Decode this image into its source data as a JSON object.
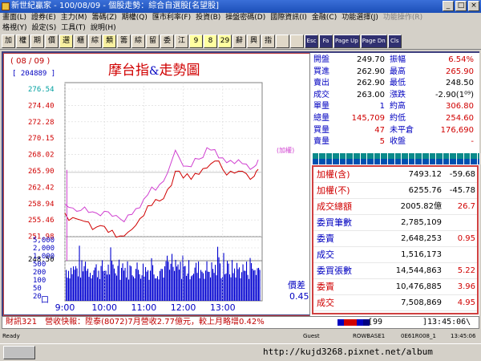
{
  "window": {
    "title": "新世紀贏家 - 100/08/09 - 個股走勢：綜合自選股[名望股]",
    "buttons": [
      "_",
      "□",
      "×"
    ]
  },
  "menu": {
    "row1": [
      "畫面(L)",
      "證券(E)",
      "主力(M)",
      "籌碼(Z)",
      "期權(Q)",
      "匯市利率(F)",
      "投資(B)",
      "操盤密碼(D)",
      "國際資訊(I)",
      "金融(C)",
      "功能選擇(J)",
      "功能操作(R)"
    ],
    "row1_dim": [
      false,
      false,
      false,
      false,
      false,
      false,
      false,
      false,
      false,
      false,
      false,
      true
    ],
    "row2": [
      "格視(Y)",
      "設定(S)",
      "工具(T)",
      "說明(H)"
    ]
  },
  "toolbar": {
    "buttons": [
      "加",
      "權",
      "期",
      "價",
      "選",
      "櫃",
      "綜",
      "類",
      "籌",
      "綜",
      "留",
      "委",
      "江",
      "9",
      "8",
      "29",
      "辭",
      "興",
      "指",
      "",
      "",
      "Esc",
      "Fa",
      "Page Up",
      "Page Dn",
      "Cls"
    ]
  },
  "chart": {
    "date": "( 08 / 09 )",
    "volume_box": "[ 204889 ]",
    "title_main": "摩台指",
    "title_amp": "&",
    "title_sub": "走勢圖",
    "weighted_label": "(加權)",
    "spread_label": "價差",
    "spread_value": "0.45",
    "volume_unit": "口"
  },
  "chart_data": {
    "type": "line",
    "price_axis_ticks": [
      "276.54",
      "274.40",
      "272.28",
      "270.15",
      "268.02",
      "265.90",
      "262.42",
      "258.94",
      "255.46",
      "251.98",
      "248.50"
    ],
    "volume_axis_ticks": [
      "5,000",
      "2,000",
      "1,000",
      "500",
      "200",
      "100",
      "50",
      "20"
    ],
    "time_ticks": [
      "9:00",
      "10:00",
      "11:00",
      "12:00",
      "13:00"
    ],
    "xlim": [
      0,
      5
    ],
    "ylim": [
      248.5,
      276.54
    ],
    "series": [
      {
        "name": "摩台指",
        "color": "#d00000",
        "x": [
          0,
          0.2,
          0.4,
          0.6,
          0.8,
          1.0,
          1.2,
          1.4,
          1.6,
          1.8,
          2.0,
          2.2,
          2.4,
          2.6,
          2.8,
          3.0,
          3.2,
          3.4,
          3.6,
          3.8,
          4.0,
          4.2,
          4.4,
          4.6,
          4.8,
          4.9
        ],
        "y": [
          256.0,
          255.3,
          254.9,
          254.6,
          253.8,
          253.9,
          253.3,
          252.4,
          253.0,
          254.1,
          255.6,
          257.2,
          257.9,
          259.7,
          262.6,
          261.5,
          261.3,
          262.1,
          263.1,
          264.2,
          262.9,
          262.6,
          262.6,
          262.2,
          261.8,
          262.9
        ]
      },
      {
        "name": "加權",
        "color": "#d040d0",
        "x": [
          0,
          0.2,
          0.4,
          0.6,
          0.8,
          1.0,
          1.2,
          1.4,
          1.6,
          1.8,
          2.0,
          2.2,
          2.4,
          2.6,
          2.8,
          3.0,
          3.2,
          3.4,
          3.6,
          3.8,
          4.0,
          4.2,
          4.4,
          4.6,
          4.8,
          4.9
        ],
        "y": [
          257.4,
          256.8,
          256.4,
          256.1,
          256.0,
          256.3,
          255.5,
          255.1,
          255.7,
          256.7,
          258.2,
          260.1,
          260.5,
          262.3,
          265.9,
          263.4,
          263.3,
          264.5,
          266.3,
          266.0,
          264.7,
          264.3,
          264.4,
          263.7,
          263.3,
          264.4
        ]
      }
    ],
    "reference_price": 262.42,
    "volume_color": "#0000d0",
    "weighted_color": "#d040d0",
    "price_color": "#d00000"
  },
  "quotes": [
    {
      "l1": "開盤",
      "v1": "249.70",
      "c1": "blk",
      "l2": "振幅",
      "v2": "6.54%",
      "c2": "red"
    },
    {
      "l1": "買進",
      "v1": "262.90",
      "c1": "blk",
      "l2": "最高",
      "v2": "265.90",
      "c2": "red"
    },
    {
      "l1": "賣出",
      "v1": "262.90",
      "c1": "blk",
      "l2": "最低",
      "v2": "248.50",
      "c2": "blk"
    },
    {
      "l1": "成交",
      "v1": "263.00",
      "c1": "blk",
      "l2": "漲跌",
      "v2": "-2.90(1⁰⁹)",
      "c2": "blk"
    },
    {
      "l1": "單量",
      "v1": "1",
      "c1": "blue",
      "l2": "約高",
      "v2": "306.80",
      "c2": "red"
    },
    {
      "l1": "總量",
      "v1": "145,709",
      "c1": "red",
      "l2": "約低",
      "v2": "254.60",
      "c2": "red"
    },
    {
      "l1": "買量",
      "v1": "47",
      "c1": "red",
      "l2": "未平倉",
      "v2": "176,690",
      "c2": "red"
    },
    {
      "l1": "賣量",
      "v1": "5",
      "c1": "red",
      "l2": "收盤",
      "v2": "-",
      "c2": "red"
    }
  ],
  "index_table": [
    {
      "label": "加權(含)",
      "lc": "red",
      "value": "7493.12",
      "change": "-59.68",
      "cc": "blk"
    },
    {
      "label": "加權(不)",
      "lc": "red",
      "value": "6255.76",
      "change": "-45.78",
      "cc": "blk"
    },
    {
      "label": "成交總額",
      "lc": "red",
      "value": "2005.82億",
      "change": "26.7",
      "cc": "red"
    },
    {
      "label": "委買筆數",
      "lc": "blue",
      "value": "2,785,109",
      "change": "",
      "cc": "red"
    },
    {
      "label": "委賣",
      "lc": "blue",
      "value": "2,648,253",
      "change": "0.95",
      "cc": "red"
    },
    {
      "label": "成交",
      "lc": "blue",
      "value": "1,516,173",
      "change": "",
      "cc": "red"
    },
    {
      "label": "委買張數",
      "lc": "blue",
      "value": "14,544,863",
      "change": "5.22",
      "cc": "red"
    },
    {
      "label": "委賣",
      "lc": "red",
      "value": "10,476,885",
      "change": "3.96",
      "cc": "red"
    },
    {
      "label": "成交",
      "lc": "red",
      "value": "7,508,869",
      "change": "4.95",
      "cc": "red"
    }
  ],
  "status_line": {
    "news": "財訊321　營收快報：陞泰(8072)7月營收2.77億元，較上月略增0.42%",
    "colors": [
      "#0000c0",
      "#d00000",
      "#d00000",
      "#0000c0",
      "#000080"
    ],
    "stock_code": "[99",
    "clock": "]13:45:06\\"
  },
  "statusbar": {
    "ready": "Ready",
    "user": "Guest",
    "server": "ROWBASE1",
    "code": "0E61R008_1",
    "time": "13:45:06"
  },
  "watermark": "http://kujd3268.pixnet.net/album"
}
